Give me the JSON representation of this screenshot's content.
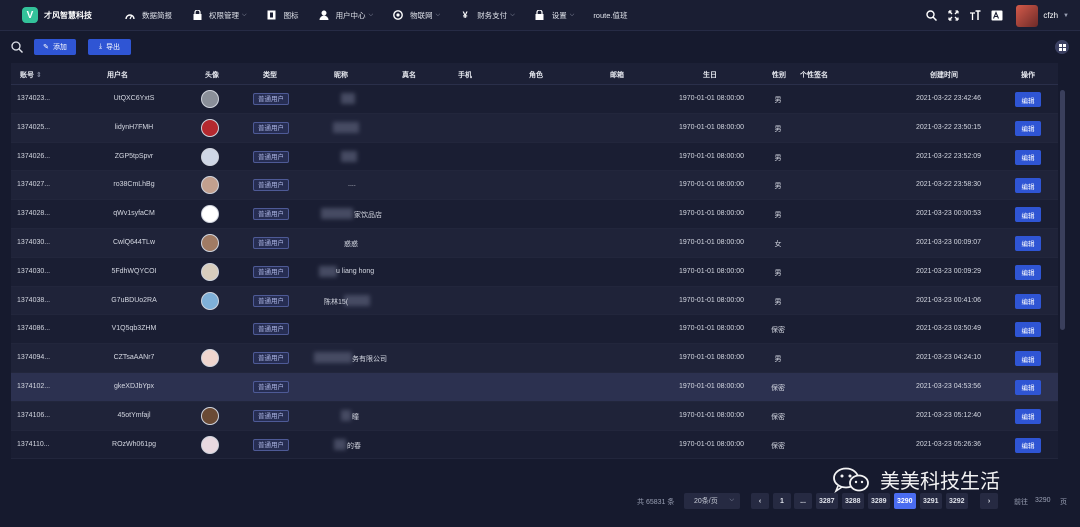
{
  "app": {
    "logo_letter": "V",
    "name": "才风智慧科技"
  },
  "menu": [
    {
      "icon": "dashboard-icon",
      "label": "数据简报",
      "dropdown": false
    },
    {
      "icon": "lock-icon",
      "label": "权限管理",
      "dropdown": true
    },
    {
      "icon": "icons-icon",
      "label": "图标",
      "dropdown": false
    },
    {
      "icon": "user-icon",
      "label": "用户中心",
      "dropdown": true
    },
    {
      "icon": "iot-icon",
      "label": "物联网",
      "dropdown": true
    },
    {
      "icon": "yen-icon",
      "label": "财务支付",
      "dropdown": true
    },
    {
      "icon": "lock-icon",
      "label": "设置",
      "dropdown": true
    },
    {
      "icon": "",
      "label": "route.值班",
      "dropdown": false
    }
  ],
  "user": {
    "name": "cfzh"
  },
  "toolbar": {
    "add_label": "添加",
    "export_label": "导出"
  },
  "table": {
    "headers": {
      "id": "账号",
      "username": "用户名",
      "avatar": "头像",
      "type": "类型",
      "nickname": "昵称",
      "realname": "真名",
      "phone": "手机",
      "role": "角色",
      "email": "邮箱",
      "birthday": "生日",
      "gender": "性别",
      "signature": "个性签名",
      "created": "创建时间",
      "action": "操作"
    },
    "edit_label": "编辑",
    "rows": [
      {
        "id": "1374023...",
        "username": "UtQXC6YxtS",
        "type": "普通用户",
        "nickname": "",
        "birthday": "1970-01-01 08:00:00",
        "gender": "男",
        "created": "2021-03-22 23:42:46"
      },
      {
        "id": "1374025...",
        "username": "lidynH7FMH",
        "type": "普通用户",
        "nickname": "",
        "birthday": "1970-01-01 08:00:00",
        "gender": "男",
        "created": "2021-03-22 23:50:15"
      },
      {
        "id": "1374026...",
        "username": "ZGP5tpSpvr",
        "type": "普通用户",
        "nickname": "",
        "birthday": "1970-01-01 08:00:00",
        "gender": "男",
        "created": "2021-03-22 23:52:09"
      },
      {
        "id": "1374027...",
        "username": "ro38CmLhBg",
        "type": "普通用户",
        "nickname": "....",
        "birthday": "1970-01-01 08:00:00",
        "gender": "男",
        "created": "2021-03-22 23:58:30"
      },
      {
        "id": "1374028...",
        "username": "qWv1syfaCM",
        "type": "普通用户",
        "nickname": "家饮品店",
        "birthday": "1970-01-01 08:00:00",
        "gender": "男",
        "created": "2021-03-23 00:00:53"
      },
      {
        "id": "1374030...",
        "username": "CwlQ644TLw",
        "type": "普通用户",
        "nickname": "惑惑",
        "birthday": "1970-01-01 08:00:00",
        "gender": "女",
        "created": "2021-03-23 00:09:07"
      },
      {
        "id": "1374030...",
        "username": "5FdhWQYCOI",
        "type": "普通用户",
        "nickname": "u liang hong",
        "birthday": "1970-01-01 08:00:00",
        "gender": "男",
        "created": "2021-03-23 00:09:29"
      },
      {
        "id": "1374038...",
        "username": "G7uBDUo2RA",
        "type": "普通用户",
        "nickname": "陈林15(",
        "birthday": "1970-01-01 08:00:00",
        "gender": "男",
        "created": "2021-03-23 00:41:06"
      },
      {
        "id": "1374086...",
        "username": "V1Q5qb3ZHM",
        "type": "普通用户",
        "nickname": "",
        "birthday": "1970-01-01 08:00:00",
        "gender": "保密",
        "created": "2021-03-23 03:50:49"
      },
      {
        "id": "1374094...",
        "username": "CZTsaAANr7",
        "type": "普通用户",
        "nickname": "务有限公司",
        "birthday": "1970-01-01 08:00:00",
        "gender": "男",
        "created": "2021-03-23 04:24:10"
      },
      {
        "id": "1374102...",
        "username": "gkeXDJbYpx",
        "type": "普通用户",
        "nickname": "",
        "birthday": "1970-01-01 08:00:00",
        "gender": "保密",
        "created": "2021-03-23 04:53:56"
      },
      {
        "id": "1374106...",
        "username": "45otYmfajl",
        "type": "普通用户",
        "nickname": "瞳",
        "birthday": "1970-01-01 08:00:00",
        "gender": "保密",
        "created": "2021-03-23 05:12:40"
      },
      {
        "id": "1374110...",
        "username": "ROzWh061pg",
        "type": "普通用户",
        "nickname": "的春",
        "birthday": "1970-01-01 08:00:00",
        "gender": "保密",
        "created": "2021-03-23 05:26:36"
      }
    ]
  },
  "pager": {
    "total": "共 65831 条",
    "page_size": "20条/页",
    "pages": [
      "1",
      "...",
      "3287",
      "3288",
      "3289",
      "3290",
      "3291",
      "3292"
    ],
    "current": "3290",
    "goto_label": "前往",
    "goto_value": "3290",
    "goto_unit": "页"
  },
  "watermark": "美美科技生活",
  "colors": {
    "accent": "#2f55d4",
    "active_page": "#4a6cf0",
    "tag_border": "#4e5a96",
    "logo": "#33c29a"
  }
}
